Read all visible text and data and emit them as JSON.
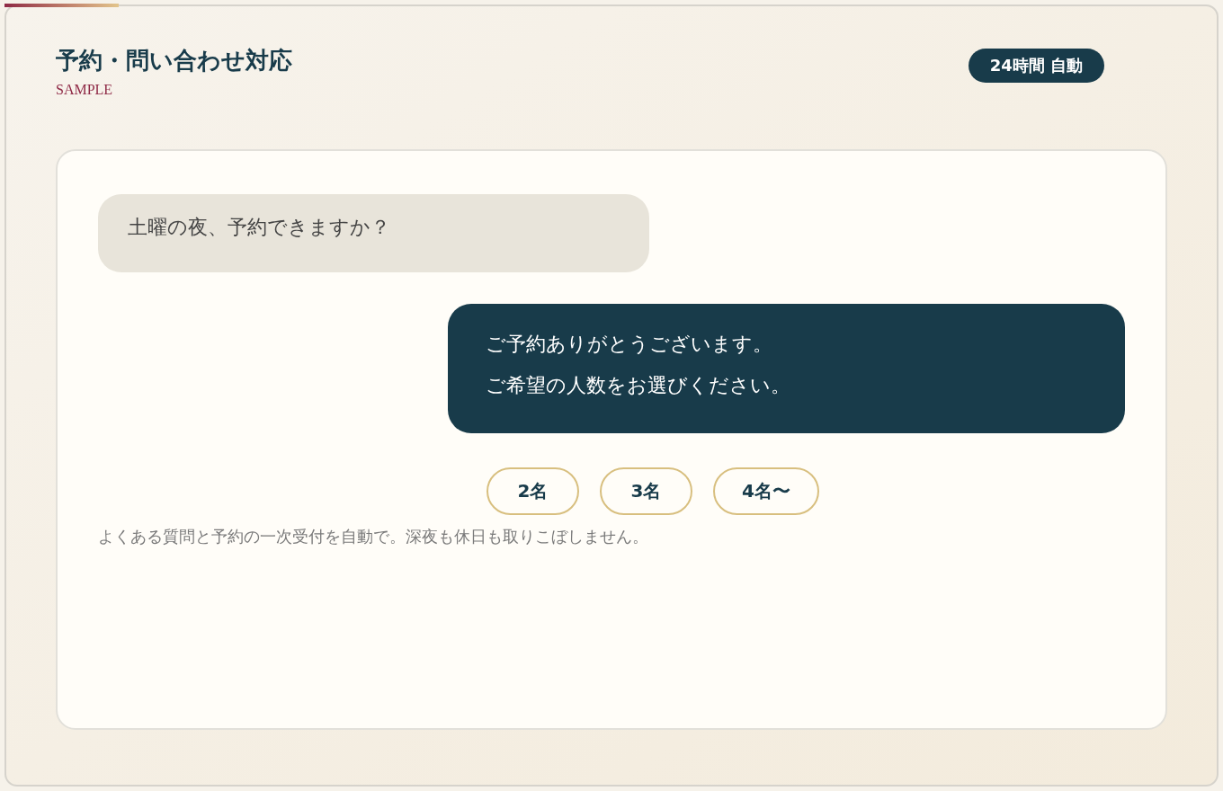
{
  "header": {
    "title": "予約・問い合わせ対応",
    "subtitle": "SAMPLE",
    "badge": "24時間 自動"
  },
  "messages": [
    {
      "kind": "user",
      "lines": [
        "土曜の夜、予約できますか？"
      ]
    },
    {
      "kind": "bot",
      "lines": [
        "ご予約ありがとうございます。",
        "ご希望の人数をお選びください。"
      ]
    }
  ],
  "choices": [
    "2名",
    "3名",
    "4名〜"
  ],
  "caption": "よくある質問と予約の一次受付を自動で。深夜も休日も取りこぼしません。"
}
